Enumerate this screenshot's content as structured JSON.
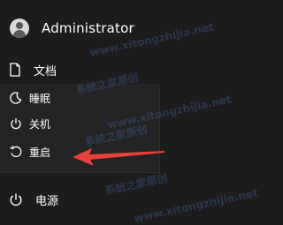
{
  "user": {
    "name": "Administrator",
    "icon": "user-avatar-icon"
  },
  "menu": {
    "documents": {
      "label": "文档",
      "icon": "document-icon"
    },
    "power": {
      "label": "电源",
      "icon": "power-icon"
    }
  },
  "power_menu": {
    "items": [
      {
        "label": "睡眠",
        "icon": "moon-icon"
      },
      {
        "label": "关机",
        "icon": "power-icon"
      },
      {
        "label": "重启",
        "icon": "restart-icon"
      }
    ]
  },
  "watermarks": {
    "url": "www.xitongzhijia.net",
    "text": "系统之家原创"
  },
  "colors": {
    "background": "#1c1c1c",
    "submenu": "#232323",
    "arrow": "#e8413a"
  }
}
